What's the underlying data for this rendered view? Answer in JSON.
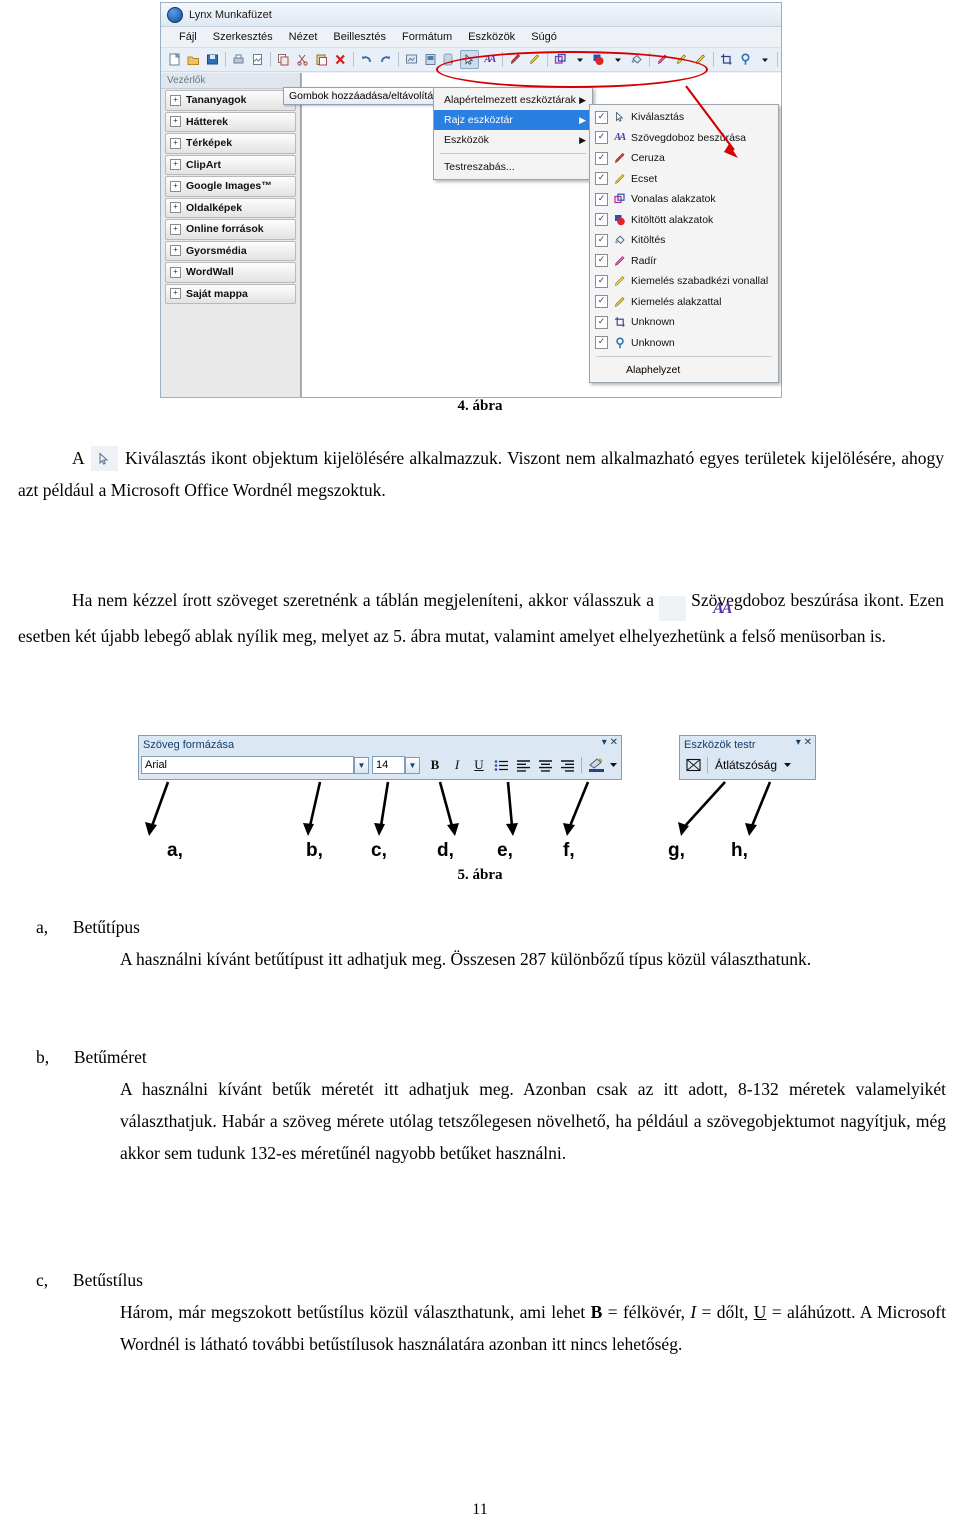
{
  "figure4": {
    "window_title": "Lynx Munkafüzet",
    "app_icon": "lynx-logo-icon",
    "menubar": [
      "Fájl",
      "Szerkesztés",
      "Nézet",
      "Beillesztés",
      "Formátum",
      "Eszközök",
      "Súgó"
    ],
    "sidebar": {
      "header": "Vezérlők",
      "items": [
        "Tananyagok",
        "Hátterek",
        "Térképek",
        "ClipArt",
        "Google Images™",
        "Oldalképek",
        "Online források",
        "Gyorsmédia",
        "WordWall",
        "Saját mappa"
      ],
      "expander_glyph": "+"
    },
    "add_remove_button": "Gombok hozzáadása/eltávolítása",
    "menu_level1": [
      {
        "label": "Alapértelmezett eszköztárak",
        "submenu": true,
        "selected": false
      },
      {
        "label": "Rajz eszköztár",
        "submenu": true,
        "selected": true
      },
      {
        "label": "Eszközök",
        "submenu": true,
        "selected": false
      },
      {
        "label": "Testreszabás...",
        "submenu": false,
        "selected": false,
        "accel": "T"
      }
    ],
    "menu_level2": {
      "items": [
        {
          "label": "Kiválasztás",
          "checked": true,
          "icon": "cursor-arrow-icon"
        },
        {
          "label": "Szövegdoboz beszúrása",
          "checked": true,
          "icon": "text-box-aa-icon"
        },
        {
          "label": "Ceruza",
          "checked": true,
          "icon": "pencil-icon"
        },
        {
          "label": "Ecset",
          "checked": true,
          "icon": "brush-icon"
        },
        {
          "label": "Vonalas alakzatok",
          "checked": true,
          "icon": "outline-shapes-icon"
        },
        {
          "label": "Kitöltött alakzatok",
          "checked": true,
          "icon": "filled-shapes-icon"
        },
        {
          "label": "Kitöltés",
          "checked": true,
          "icon": "paint-bucket-icon"
        },
        {
          "label": "Radír",
          "checked": true,
          "icon": "eraser-icon"
        },
        {
          "label": "Kiemelés szabadkézi vonallal",
          "checked": true,
          "icon": "highlighter-freehand-icon"
        },
        {
          "label": "Kiemelés alakzattal",
          "checked": true,
          "icon": "highlighter-shape-icon"
        },
        {
          "label": "Unknown",
          "checked": true,
          "icon": "crop-icon"
        },
        {
          "label": "Unknown",
          "checked": true,
          "icon": "spotlight-icon"
        }
      ],
      "footer": "Alaphelyzet"
    },
    "annotation": {
      "shape": "red-ellipse",
      "color": "#d40000"
    },
    "caption": "4. ábra"
  },
  "paragraph1": {
    "before_icon": "A",
    "icon": "cursor-arrow-icon",
    "text": "Kiválasztás ikont objektum kijelölésére alkalmazzuk. Viszont nem alkalmazható egyes területek kijelölésére, ahogy azt például a Microsoft Office Wordnél megszoktuk."
  },
  "paragraph2": {
    "text_a": "Ha nem kézzel írott szöveget szeretnénk a táblán megjeleníteni, akkor válasszuk a",
    "icon": "text-box-aa-icon",
    "text_b": "Szövegdoboz beszúrása ikont. Ezen esetben két újabb lebegő ablak nyílik meg, melyet az 5. ábra mutat, valamint amelyet elhelyezhetünk a felső menüsorban is."
  },
  "figure5": {
    "caption": "5. ábra",
    "toolbar_text": {
      "title": "Szöveg formázása",
      "font_value": "Arial",
      "size_value": "14",
      "buttons": [
        {
          "label": "B",
          "name": "bold-button"
        },
        {
          "label": "I",
          "name": "italic-button"
        },
        {
          "label": "U",
          "name": "underline-button"
        },
        {
          "label": "≡",
          "name": "bullet-list-button"
        },
        {
          "label": "≡",
          "name": "align-left-button"
        },
        {
          "label": "≡",
          "name": "align-center-button"
        },
        {
          "label": "≡",
          "name": "align-right-button"
        },
        {
          "label": "",
          "name": "text-color-button"
        }
      ],
      "caption_controls": [
        "▾",
        "✕"
      ]
    },
    "toolbar_tools": {
      "title": "Eszközök testr",
      "transparency_label": "Átlátszóság",
      "caption_controls": [
        "▾",
        "✕"
      ]
    },
    "arrow_labels": [
      "a,",
      "b,",
      "c,",
      "d,",
      "e,",
      "f,",
      "g,",
      "h,"
    ]
  },
  "list": [
    {
      "marker": "a,",
      "title": "Betűtípus",
      "body": "A használni kívánt betűtípust itt adhatjuk meg. Összesen 287 különbőzű típus közül választhatunk."
    },
    {
      "marker": "b,",
      "title": "Betűméret",
      "body": "A használni kívánt betűk méretét itt adhatjuk meg. Azonban csak az itt adott, 8-132 méretek valamelyikét választhatjuk. Habár a szöveg mérete utólag tetszőlegesen növelhető, ha például a szövegobjektumot nagyítjuk, még akkor sem tudunk 132-es méretűnél nagyobb betűket használni."
    },
    {
      "marker": "c,",
      "title": "Betűstílus",
      "body_prefix": "Három, már megszokott betűstílus közül választhatunk, ami lehet ",
      "bold_token": "B",
      "body_mid1": " = félkövér, ",
      "italic_token": "I",
      "body_mid2": " = dőlt, ",
      "underline_token": "U",
      "body_suffix": " = aláhúzott. A Microsoft Wordnél is látható további betűstílusok használatára azonban itt nincs lehetőség."
    }
  ],
  "page_number": "11",
  "colors": {
    "annotation_red": "#d40000",
    "menu_highlight": "#2a7fe0",
    "toolbar_blue": "#dbe7f2",
    "toolbar_border": "#7f9db9"
  }
}
